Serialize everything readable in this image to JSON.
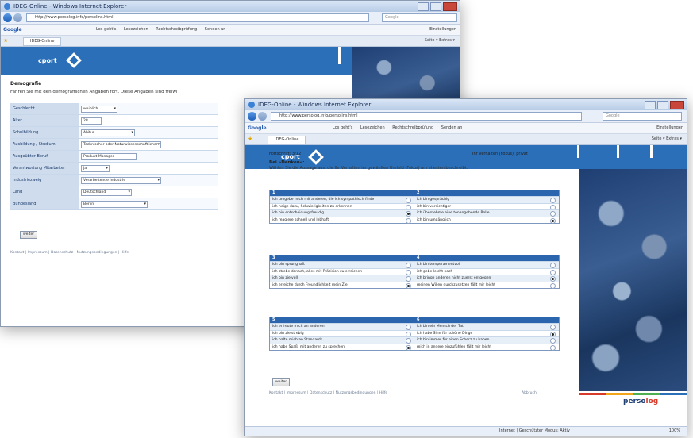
{
  "window1": {
    "title": "IDEG-Online - Windows Internet Explorer",
    "url": "http://www.persolog.info/persolins.html",
    "search_placeholder": "Google",
    "google_label": "Google",
    "google_items": [
      "Los geht's",
      "Lesezeichen",
      "Rechtschreibprüfung",
      "Senden an"
    ],
    "google_settings": "Einstellungen",
    "tab_label": "IDEG-Online",
    "tools": "Seite ▾  Extras ▾",
    "brand": "cport",
    "heading": "Demografie",
    "intro": "Fahren Sie mit den demografischen Angaben fort. Diese Angaben sind freiwi",
    "form": [
      {
        "label": "Geschlecht",
        "value": "weiblich",
        "type": "select"
      },
      {
        "label": "Alter",
        "value": "28",
        "type": "input"
      },
      {
        "label": "Schulbildung",
        "value": "Abitur",
        "type": "select"
      },
      {
        "label": "Ausbildung / Studium",
        "value": "Technischer oder Naturwissenschaftlicher",
        "type": "select"
      },
      {
        "label": "Ausgeübter Beruf",
        "value": "Produkt-Manager",
        "type": "input"
      },
      {
        "label": "Verantwortung Mitarbeiter",
        "value": "Ja",
        "type": "select"
      },
      {
        "label": "Industriezweig",
        "value": "Verarbeitende Industrie",
        "type": "select"
      },
      {
        "label": "Land",
        "value": "Deutschland",
        "type": "select"
      },
      {
        "label": "Bundesland",
        "value": "Berlin",
        "type": "select"
      }
    ],
    "next_button": "weiter",
    "footer": "Kontakt | Impressum | Datenschutz | Nutzungsbedingungen | Hilfe"
  },
  "window2": {
    "title": "IDEG-Online - Windows Internet Explorer",
    "url": "http://www.persolog.info/persolins.html",
    "search_placeholder": "Google",
    "google_label": "Google",
    "google_items": [
      "Los geht's",
      "Lesezeichen",
      "Rechtschreibprüfung",
      "Senden an"
    ],
    "google_settings": "Einstellungen",
    "tab_label": "IDEG-Online",
    "tools": "Seite ▾  Extras ▾",
    "brand": "cport",
    "progress_left": "Fortschritt: 3/12",
    "progress_right": "Ihr Verhalten (Fokus): privat",
    "instruction_title": "Bei »Denken«:",
    "instruction": "Wählen Sie die Aussage aus, die Ihr Verhalten im gewählten Umfeld (Fokus) am ehesten beschreibt.",
    "blocks": [
      {
        "num": "1",
        "items": [
          {
            "text": "ich umgebe mich mit anderen, die ich sympathisch finde",
            "checked": false
          },
          {
            "text": "ich neige dazu, Schwierigkeiten zu erkennen",
            "checked": false
          },
          {
            "text": "ich bin entscheidungsfreudig",
            "checked": true
          },
          {
            "text": "ich reagiere schnell und lebhaft",
            "checked": false
          }
        ]
      },
      {
        "num": "2",
        "items": [
          {
            "text": "ich bin gesprächig",
            "checked": false
          },
          {
            "text": "ich bin vorsichtiger",
            "checked": false
          },
          {
            "text": "ich übernehme eine tonangebende Rolle",
            "checked": false
          },
          {
            "text": "ich bin umgänglich",
            "checked": true
          }
        ]
      },
      {
        "num": "3",
        "items": [
          {
            "text": "ich bin sprunghaft",
            "checked": false
          },
          {
            "text": "ich strebe danach, alles mit Präzision zu erreichen",
            "checked": false
          },
          {
            "text": "ich bin zielvoll",
            "checked": false
          },
          {
            "text": "ich erreiche durch Freundlichkeit mein Ziel",
            "checked": true
          }
        ]
      },
      {
        "num": "4",
        "items": [
          {
            "text": "ich bin temperamentvoll",
            "checked": false
          },
          {
            "text": "ich gebe leicht nach",
            "checked": false
          },
          {
            "text": "ich bringe anderen nicht zuerst entgegen",
            "checked": true
          },
          {
            "text": "meinen Willen durchzusetzen fällt mir leicht",
            "checked": false
          }
        ]
      },
      {
        "num": "5",
        "items": [
          {
            "text": "ich erfreute mich an anderen",
            "checked": false
          },
          {
            "text": "ich bin zielstrebig",
            "checked": false
          },
          {
            "text": "ich halte mich an Standards",
            "checked": false
          },
          {
            "text": "ich habe Spaß, mit anderen zu sprechen",
            "checked": true
          }
        ]
      },
      {
        "num": "6",
        "items": [
          {
            "text": "ich bin ein Mensch der Tat",
            "checked": false
          },
          {
            "text": "ich habe Sinn für schöne Dinge",
            "checked": true
          },
          {
            "text": "ich bin immer für einen Scherz zu haben",
            "checked": false
          },
          {
            "text": "mich in andere einzufühlen fällt mir leicht",
            "checked": false
          }
        ]
      }
    ],
    "next_button": "weiter",
    "footer": "Kontakt | Impressum | Datenschutz | Nutzungsbedingungen | Hilfe",
    "footer_right": "Abbruch",
    "status": "Internet | Geschützter Modus: Aktiv",
    "zoom": "100%",
    "personality_a": "perso",
    "personality_b": "log",
    "colors": {
      "accent": "#2a6fb8",
      "header_blue": "#2a65ad",
      "label_bg": "#cfdcee"
    }
  }
}
